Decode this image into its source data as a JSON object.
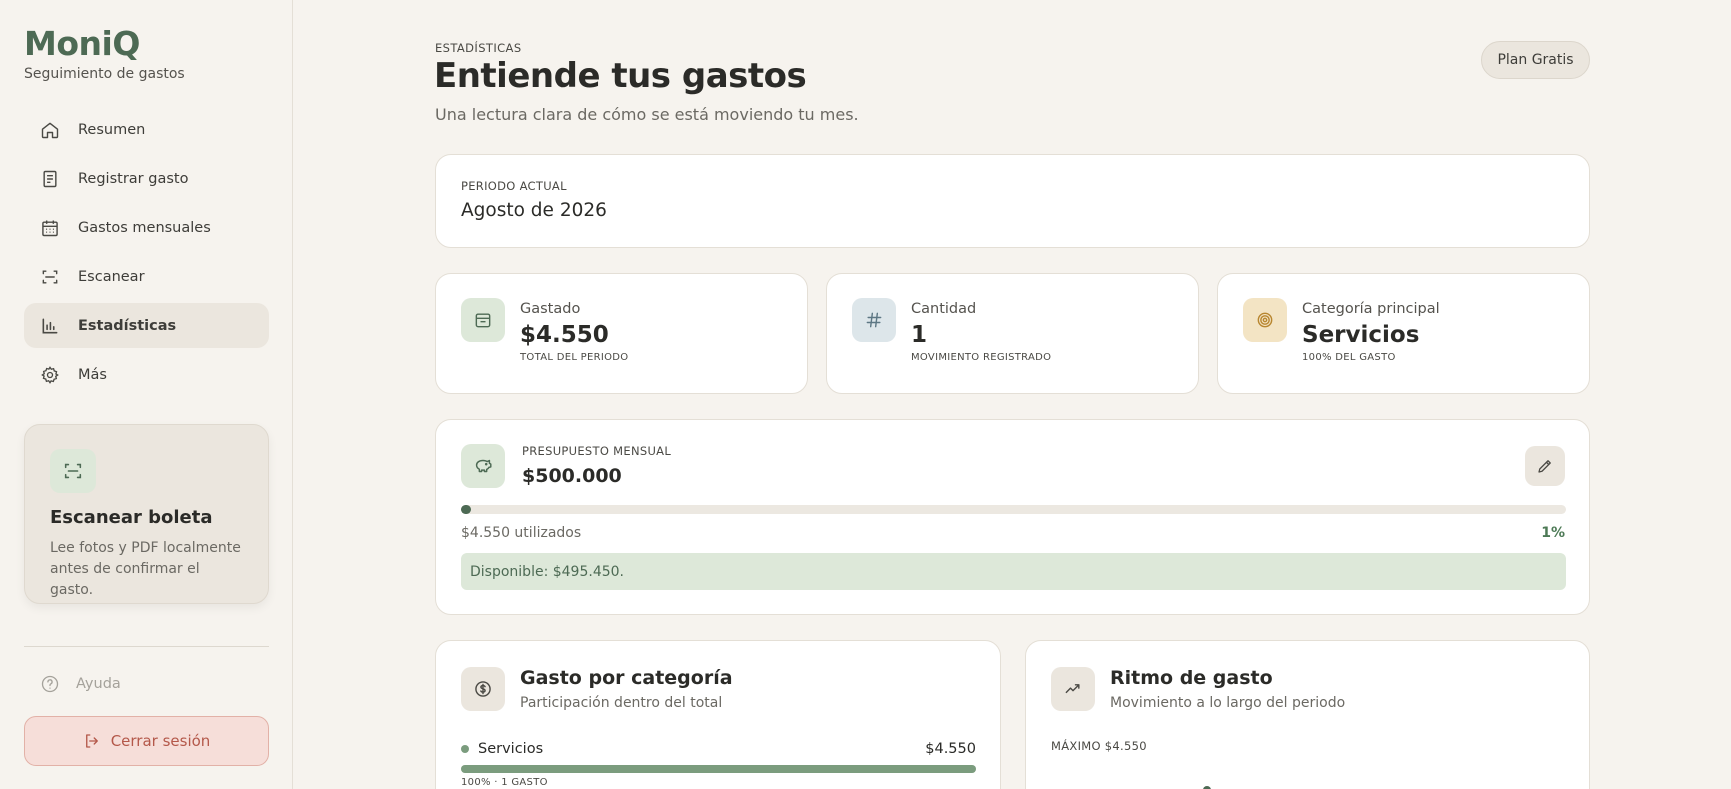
{
  "brand": {
    "name": "MoniQ",
    "subtitle": "Seguimiento de gastos"
  },
  "nav": {
    "items": [
      {
        "label": "Resumen",
        "icon": "home-icon"
      },
      {
        "label": "Registrar gasto",
        "icon": "receipt-icon"
      },
      {
        "label": "Gastos mensuales",
        "icon": "calendar-icon"
      },
      {
        "label": "Escanear",
        "icon": "scan-icon"
      },
      {
        "label": "Estadísticas",
        "icon": "bar-chart-icon",
        "active": true
      },
      {
        "label": "Más",
        "icon": "gear-icon"
      }
    ]
  },
  "scan_card": {
    "title": "Escanear boleta",
    "description": "Lee fotos y PDF localmente antes de confirmar el gasto."
  },
  "footer": {
    "help_label": "Ayuda",
    "logout_label": "Cerrar sesión"
  },
  "header": {
    "eyebrow": "ESTADÍSTICAS",
    "title": "Entiende tus gastos",
    "subtitle": "Una lectura clara de cómo se está moviendo tu mes.",
    "plan_label": "Plan Gratis"
  },
  "period": {
    "label": "PERIODO ACTUAL",
    "value": "Agosto de 2026"
  },
  "stats": [
    {
      "label": "Gastado",
      "value": "$4.550",
      "sub": "TOTAL DEL PERIODO",
      "icon": "wallet-icon",
      "color": "#dde8d9"
    },
    {
      "label": "Cantidad",
      "value": "1",
      "sub": "MOVIMIENTO REGISTRADO",
      "icon": "hash-icon",
      "color": "#dde6ea"
    },
    {
      "label": "Categoría principal",
      "value": "Servicios",
      "sub": "100% DEL GASTO",
      "icon": "target-icon",
      "color": "#f3e4c4"
    }
  ],
  "budget": {
    "label": "PRESUPUESTO MENSUAL",
    "value": "$500.000",
    "used_text": "$4.550 utilizados",
    "percent_text": "1%",
    "progress": 0.0091,
    "available_text": "Disponible: $495.450."
  },
  "category_panel": {
    "title": "Gasto por categoría",
    "subtitle": "Participación dentro del total",
    "rows": [
      {
        "name": "Servicios",
        "amount": "$4.550",
        "share": 1.0,
        "meta": "100% · 1 GASTO"
      }
    ]
  },
  "rhythm_panel": {
    "title": "Ritmo de gasto",
    "subtitle": "Movimiento a lo largo del periodo",
    "max_label": "MÁXIMO $4.550"
  },
  "colors": {
    "accent": "#4d6a54",
    "background": "#f6f3ee",
    "danger": "#b4584a"
  }
}
